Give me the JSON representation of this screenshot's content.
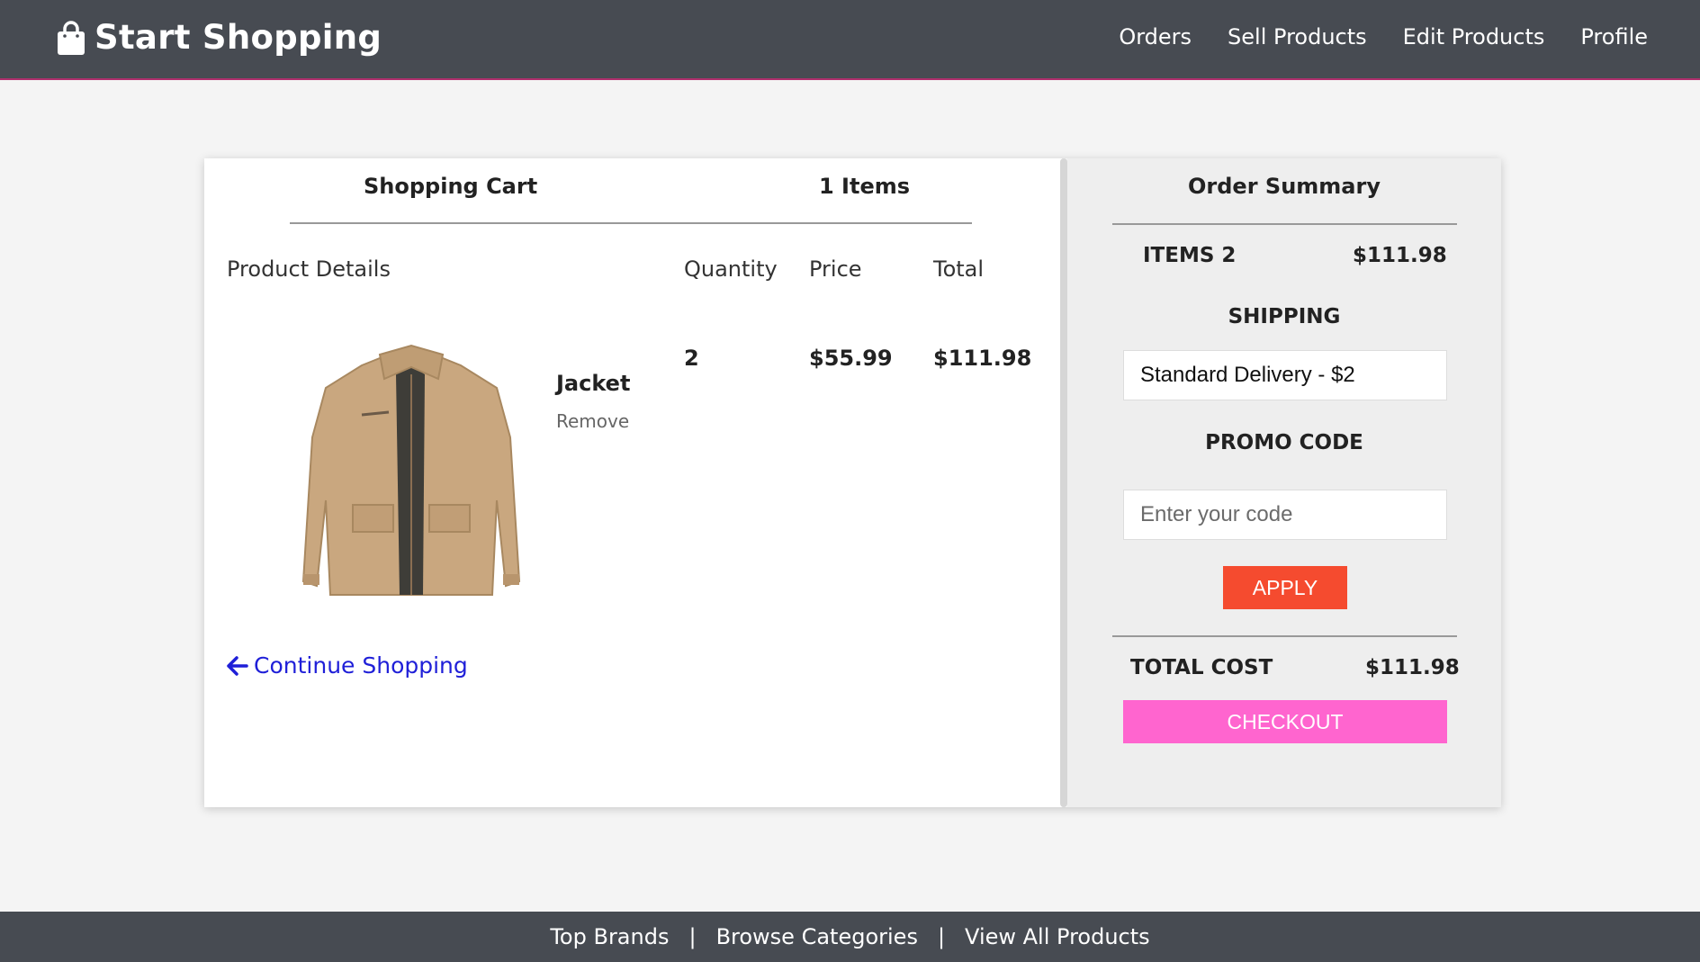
{
  "navbar": {
    "brand": "Start Shopping",
    "brand_icon": "shopping-bag-icon",
    "links": [
      "Orders",
      "Sell Products",
      "Edit Products",
      "Profile"
    ]
  },
  "cart": {
    "title": "Shopping Cart",
    "count": "1 Items",
    "columns": {
      "product": "Product Details",
      "quantity": "Quantity",
      "price": "Price",
      "total": "Total"
    },
    "item": {
      "name": "Jacket",
      "remove": "Remove",
      "quantity": "2",
      "price": "$55.99",
      "total": "$111.98",
      "image": "tan-jacket-image"
    },
    "continue": "Continue Shopping"
  },
  "summary": {
    "title": "Order Summary",
    "items_label": "ITEMS 2",
    "items_value": "$111.98",
    "shipping_label": "SHIPPING",
    "shipping_selected": "Standard Delivery - $2",
    "promo_label": "PROMO CODE",
    "promo_placeholder": "Enter your code",
    "apply": "APPLY",
    "total_label": "TOTAL COST",
    "total_value": "$111.98",
    "checkout": "CHECKOUT"
  },
  "footer": {
    "links": [
      "Top Brands",
      "Browse Categories",
      "View All Products"
    ],
    "separator": "|"
  },
  "colors": {
    "nav_bg": "#474b52",
    "apply_bg": "#f54b2f",
    "checkout_bg": "#ff65cf",
    "link_blue": "#1f1fd8"
  }
}
